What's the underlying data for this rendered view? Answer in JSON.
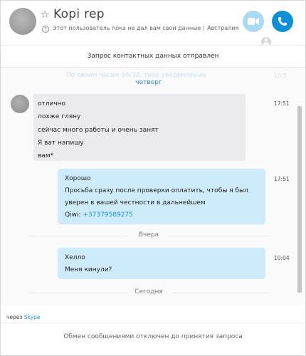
{
  "header": {
    "contact_name": "Kopi rep",
    "status_text": "Этот пользователь пока не дал вам свои данные",
    "location": "Австралия",
    "separator": "|"
  },
  "banner": {
    "text": "Запрос контактных данных отправлен"
  },
  "conversation": {
    "ghost_text": "По своим часам 16:30, твоё уведомление",
    "ghost_time": "10:5",
    "day_thursday": "четверг",
    "incoming": {
      "time": "17:51",
      "lines": [
        "отлично",
        "похже гляну",
        "сейчас много работы и очень занят",
        "Я ват напишу",
        "вам*"
      ]
    },
    "outgoing_1": {
      "time": "17:51",
      "line1": "Хорошо",
      "line2": "Просьба сразу после проверки оплатить, чтобы я был",
      "line3": "уверен в вашей честности в дальнейшем",
      "qiwi_label": "Qiwi:",
      "qiwi_number": "+37379589275"
    },
    "day_yesterday": "Вчера",
    "outgoing_2": {
      "time": "10:04",
      "line1": "Хелло",
      "line2": "Меня кинули?"
    },
    "day_today": "Сегодня"
  },
  "footer": {
    "via_prefix": "через",
    "via_link": "Skype",
    "note": "Обмен сообщениями отключен до принятия запроса"
  },
  "colors": {
    "accent": "#0f8fd6",
    "outgoing_bubble": "#cdebfb",
    "incoming_bubble": "#ebebed"
  }
}
